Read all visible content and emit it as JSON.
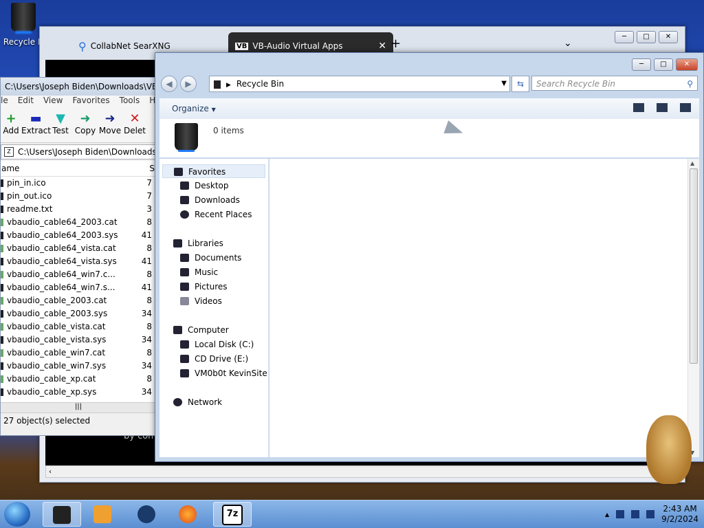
{
  "desktop": {
    "recycle_label": "Recycle B"
  },
  "browser": {
    "tabs": [
      {
        "label": "CollabNet SearXNG",
        "close": "✕"
      },
      {
        "label": "VB-Audio Virtual Apps",
        "close": "✕",
        "icon": "VB"
      }
    ],
    "new_tab": "+",
    "tab_list": "⌄",
    "footer_text": "by com"
  },
  "zip": {
    "title": "C:\\Users\\Joseph Biden\\Downloads\\VBCA",
    "menu": [
      "le",
      "Edit",
      "View",
      "Favorites",
      "Tools",
      "Help"
    ],
    "toolbar": [
      {
        "label": "Add",
        "icon": "+"
      },
      {
        "label": "Extract",
        "icon": "▬"
      },
      {
        "label": "Test",
        "icon": "▼"
      },
      {
        "label": "Copy",
        "icon": "➜"
      },
      {
        "label": "Move",
        "icon": "➜"
      },
      {
        "label": "Delet",
        "icon": "✕"
      }
    ],
    "address": "C:\\Users\\Joseph Biden\\Downloads",
    "columns": {
      "name": "Name",
      "size": "S"
    },
    "files": [
      {
        "name": "pin_in.ico",
        "size": "7"
      },
      {
        "name": "pin_out.ico",
        "size": "7"
      },
      {
        "name": "readme.txt",
        "size": "3"
      },
      {
        "name": "vbaudio_cable64_2003.cat",
        "size": "8"
      },
      {
        "name": "vbaudio_cable64_2003.sys",
        "size": "41"
      },
      {
        "name": "vbaudio_cable64_vista.cat",
        "size": "8"
      },
      {
        "name": "vbaudio_cable64_vista.sys",
        "size": "41"
      },
      {
        "name": "vbaudio_cable64_win7.c...",
        "size": "8"
      },
      {
        "name": "vbaudio_cable64_win7.s...",
        "size": "41"
      },
      {
        "name": "vbaudio_cable_2003.cat",
        "size": "8"
      },
      {
        "name": "vbaudio_cable_2003.sys",
        "size": "34"
      },
      {
        "name": "vbaudio_cable_vista.cat",
        "size": "8"
      },
      {
        "name": "vbaudio_cable_vista.sys",
        "size": "34"
      },
      {
        "name": "vbaudio_cable_win7.cat",
        "size": "8"
      },
      {
        "name": "vbaudio_cable_win7.sys",
        "size": "34"
      },
      {
        "name": "vbaudio_cable_xp.cat",
        "size": "8"
      },
      {
        "name": "vbaudio_cable_xp.sys",
        "size": "34"
      }
    ],
    "status": "27 object(s) selected"
  },
  "explorer": {
    "address_label": "Recycle Bin",
    "search_placeholder": "Search Recycle Bin",
    "organize": "Organize",
    "items_count": "0 items",
    "nav": {
      "favorites": {
        "label": "Favorites",
        "items": [
          "Desktop",
          "Downloads",
          "Recent Places"
        ]
      },
      "libraries": {
        "label": "Libraries",
        "items": [
          "Documents",
          "Music",
          "Pictures",
          "Videos"
        ]
      },
      "computer": {
        "label": "Computer",
        "items": [
          "Local Disk (C:)",
          "CD Drive (E:)",
          "VM0b0t KevinSite"
        ]
      },
      "network": {
        "label": "Network"
      }
    }
  },
  "taskbar": {
    "time": "2:43 AM",
    "date": "9/2/2024",
    "apps": [
      "explorer-icon",
      "media-player-icon",
      "globe-icon",
      "firefox-icon",
      "7zip-icon"
    ],
    "zip_label": "7z"
  }
}
